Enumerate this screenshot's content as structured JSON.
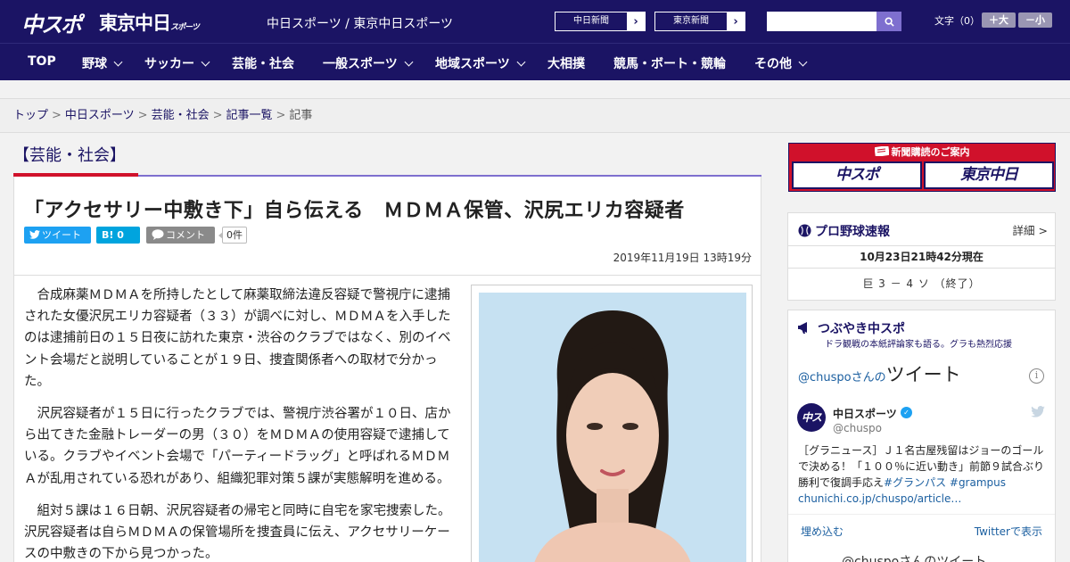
{
  "header": {
    "logo_chuspo": "中スポ",
    "logo_tokyo": "東京中日",
    "logo_tokyo_suffix": "スポーツ",
    "site_title": "中日スポーツ / 東京中日スポーツ",
    "ext_links": [
      {
        "label": "中日新聞",
        "arrow": "›"
      },
      {
        "label": "東京新聞",
        "arrow": "›"
      }
    ],
    "search_placeholder": "",
    "font_size_label": "文字（0）",
    "font_larger": "＋大",
    "font_smaller": "－小"
  },
  "nav": {
    "items": [
      {
        "label": "TOP"
      },
      {
        "label": "野球"
      },
      {
        "label": "サッカー"
      },
      {
        "label": "芸能・社会"
      },
      {
        "label": "一般スポーツ"
      },
      {
        "label": "地域スポーツ"
      },
      {
        "label": "大相撲"
      },
      {
        "label": "競馬・ボート・競輪"
      },
      {
        "label": "その他"
      }
    ]
  },
  "breadcrumb": {
    "items": [
      "トップ",
      "中日スポーツ",
      "芸能・社会",
      "記事一覧"
    ],
    "current": "記事",
    "separator": ">"
  },
  "section": {
    "title": "【芸能・社会】"
  },
  "article": {
    "headline": "「アクセサリー中敷き下」自ら伝える　ＭＤＭＡ保管、沢尻エリカ容疑者",
    "share": {
      "tweet": "ツイート",
      "hatena": "B! 0",
      "comment": "コメント",
      "count": "0件"
    },
    "timestamp": "2019年11月19日 13時19分",
    "paragraphs": [
      "合成麻薬ＭＤＭＡを所持したとして麻薬取締法違反容疑で警視庁に逮捕された女優沢尻エリカ容疑者（３３）が調べに対し、ＭＤＭＡを入手したのは逮捕前日の１５日夜に訪れた東京・渋谷のクラブではなく、別のイベント会場だと説明していることが１９日、捜査関係者への取材で分かった。",
      "沢尻容疑者が１５日に行ったクラブでは、警視庁渋谷署が１０日、店から出てきた金融トレーダーの男（３０）をＭＤＭＡの使用容疑で逮捕している。クラブやイベント会場で「パーティードラッグ」と呼ばれるＭＤＭＡが乱用されている恐れがあり、組織犯罪対策５課が実態解明を進める。",
      "組対５課は１６日朝、沢尻容疑者の帰宅と同時に自宅を家宅捜索した。沢尻容疑者は自らＭＤＭＡの保管場所を捜査員に伝え、アクセサリーケースの中敷きの下から見つかった。"
    ]
  },
  "sidebar": {
    "subscribe": {
      "title": "新聞購読のご案内",
      "left": "中スポ",
      "right": "東京中日"
    },
    "baseball": {
      "title": "プロ野球速報",
      "detail": "詳細 >",
      "updated": "10月23日21時42分現在",
      "score": "巨 3 － 4 ソ （終了）"
    },
    "twitter": {
      "title": "つぶやき中スポ",
      "subtitle": "ドラ観戦の本紙評論家も語る。グラも熱烈応援",
      "header_handle": "@chuspo",
      "header_suffix": "さんの",
      "header_big": "ツイート",
      "name": "中日スポーツ",
      "handle": "@chuspo",
      "text": "［グラニュース］Ｊ１名古屋残留はジョーのゴールで決める！「１００％に近い動き」前節９試合ぶり勝利で復調手応え",
      "hashtags": "#グランパス #grampus",
      "link": "chunichi.co.jp/chuspo/article…",
      "embed": "埋め込む",
      "view_on": "Twitterで表示",
      "next_header": "@chuspoさんのツイート"
    }
  },
  "colors": {
    "brand_navy": "#1b1464",
    "accent_red": "#d0112b",
    "accent_purple": "#7e6fcf",
    "twitter_blue": "#1da1f2"
  }
}
